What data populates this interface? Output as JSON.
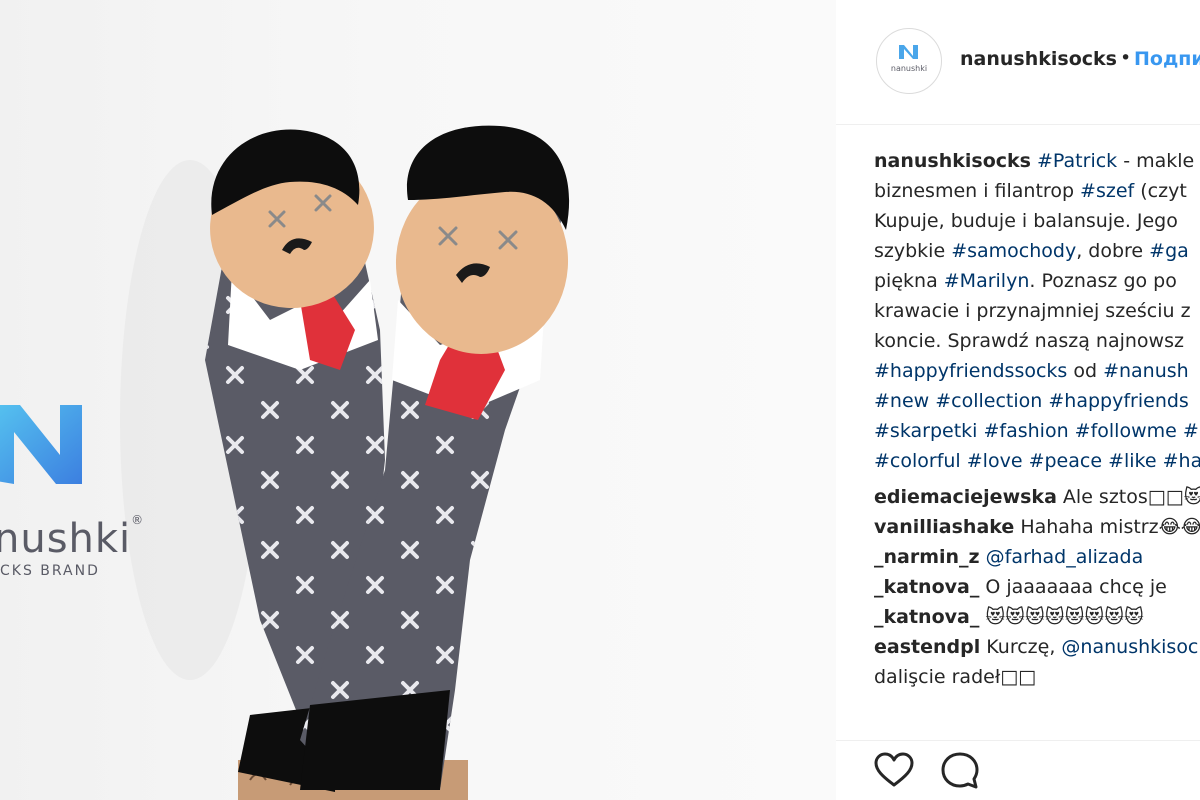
{
  "post": {
    "username": "nanushkisocks",
    "separator": "•",
    "follow_label": "Подпи",
    "avatar_logo_letter": "N",
    "avatar_logo_text": "nanushki"
  },
  "brand_overlay": {
    "logo_letter": "N",
    "wordmark": "nushki",
    "registered": "®",
    "tagline": "CKS BRAND"
  },
  "caption": {
    "username": "nanushkisocks",
    "lines": [
      [
        {
          "t": " ",
          "k": "text"
        },
        {
          "t": "#Patrick",
          "k": "tag"
        },
        {
          "t": " - makle",
          "k": "text"
        }
      ],
      [
        {
          "t": "biznesmen i filantrop ",
          "k": "text"
        },
        {
          "t": "#szef",
          "k": "tag"
        },
        {
          "t": " (czyt",
          "k": "text"
        }
      ],
      [
        {
          "t": "Kupuje, buduje i balansuje. Jego",
          "k": "text"
        }
      ],
      [
        {
          "t": "szybkie ",
          "k": "text"
        },
        {
          "t": "#samochody",
          "k": "tag"
        },
        {
          "t": ", dobre ",
          "k": "text"
        },
        {
          "t": "#ga",
          "k": "tag"
        }
      ],
      [
        {
          "t": "piękna ",
          "k": "text"
        },
        {
          "t": "#Marilyn",
          "k": "tag"
        },
        {
          "t": ". Poznasz go po",
          "k": "text"
        }
      ],
      [
        {
          "t": "krawacie i przynajmniej sześciu z",
          "k": "text"
        }
      ],
      [
        {
          "t": "koncie. Sprawdź naszą najnowsz",
          "k": "text"
        }
      ],
      [
        {
          "t": "#happyfriendssocks",
          "k": "tag"
        },
        {
          "t": " od ",
          "k": "text"
        },
        {
          "t": "#nanush",
          "k": "tag"
        }
      ],
      [
        {
          "t": "#new",
          "k": "tag"
        },
        {
          "t": " ",
          "k": "text"
        },
        {
          "t": "#collection",
          "k": "tag"
        },
        {
          "t": " ",
          "k": "text"
        },
        {
          "t": "#happyfriends",
          "k": "tag"
        }
      ],
      [
        {
          "t": "#skarpetki",
          "k": "tag"
        },
        {
          "t": " ",
          "k": "text"
        },
        {
          "t": "#fashion",
          "k": "tag"
        },
        {
          "t": " ",
          "k": "text"
        },
        {
          "t": "#followme",
          "k": "tag"
        },
        {
          "t": " #",
          "k": "tag"
        }
      ],
      [
        {
          "t": "#colorful",
          "k": "tag"
        },
        {
          "t": " ",
          "k": "text"
        },
        {
          "t": "#love",
          "k": "tag"
        },
        {
          "t": " ",
          "k": "text"
        },
        {
          "t": "#peace",
          "k": "tag"
        },
        {
          "t": " ",
          "k": "text"
        },
        {
          "t": "#like",
          "k": "tag"
        },
        {
          "t": " ",
          "k": "text"
        },
        {
          "t": "#ha",
          "k": "tag"
        }
      ]
    ]
  },
  "comments": [
    {
      "user": "ediemaciejewska",
      "text": " Ale sztos□□😻"
    },
    {
      "user": "vanilliashake",
      "text": " Hahaha mistrz😂😂"
    },
    {
      "user": "_narmin_z",
      "text": " ",
      "mention": "@farhad_alizada"
    },
    {
      "user": "_katnova_",
      "text": "  O jaaaaaaa chcę je"
    },
    {
      "user": "_katnova_",
      "text": "  😻😻😻😻😻😻😻😻"
    },
    {
      "user": "eastendpl",
      "text": " Kurczę, ",
      "mention": "@nanushkisoc",
      "text2": "dalişcie radeł□□"
    }
  ],
  "actions": {
    "like_icon": "heart-outline-icon",
    "comment_icon": "speech-bubble-icon"
  },
  "colors": {
    "link": "#003569",
    "follow": "#3897f0",
    "sock_body": "#5a5b66",
    "sock_black": "#0d0d0d",
    "tie": "#e0313a",
    "skin": "#e9b98e",
    "logo_blue": "#4aa6ea"
  }
}
